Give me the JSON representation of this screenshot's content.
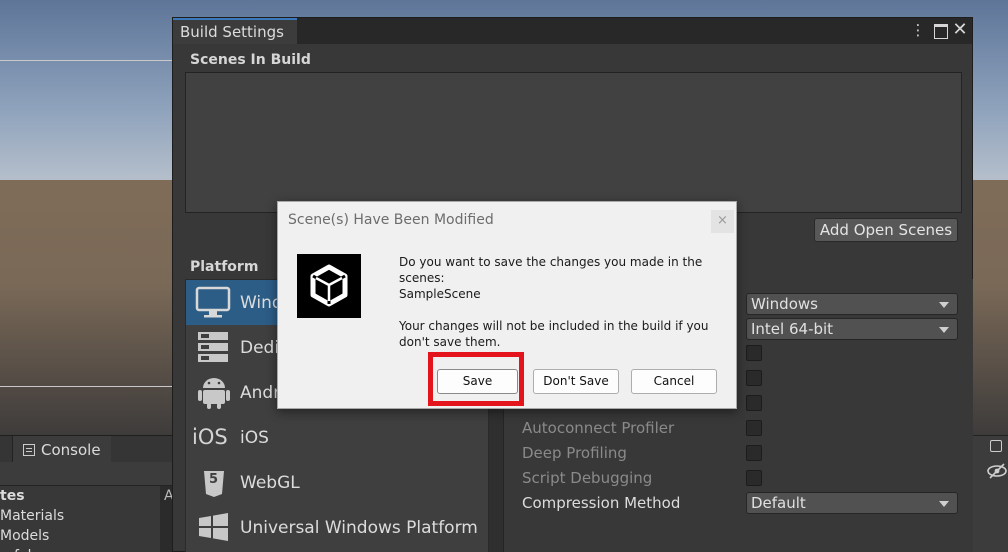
{
  "console": {
    "tab_label": "Console"
  },
  "project_tree": {
    "header": "tes",
    "items": [
      "Materials",
      "Models",
      "refabs"
    ],
    "sep_glyph": "A"
  },
  "build_window": {
    "title": "Build Settings",
    "scenes_label": "Scenes In Build",
    "add_open_scenes": "Add Open Scenes",
    "platform_label": "Platform",
    "platforms": [
      {
        "label": "Windows",
        "icon": "monitor-icon"
      },
      {
        "label": "Dedicated Server",
        "icon": "server-icon"
      },
      {
        "label": "Android",
        "icon": "android-icon"
      },
      {
        "label": "iOS",
        "icon": "ios-icon",
        "icon_text": "iOS"
      },
      {
        "label": "WebGL",
        "icon": "html5-icon",
        "icon_text": "5"
      },
      {
        "label": "Universal Windows Platform",
        "icon": "windows-logo-icon"
      }
    ],
    "settings": {
      "target_platform_value": "Windows",
      "architecture_value": "Intel 64-bit",
      "autoconnect_profiler": "Autoconnect Profiler",
      "deep_profiling": "Deep Profiling",
      "script_debugging": "Script Debugging",
      "compression_method": "Compression Method",
      "compression_value": "Default"
    }
  },
  "dialog": {
    "title": "Scene(s) Have Been Modified",
    "close_glyph": "×",
    "message_line1": "Do you want to save the changes you made in the",
    "message_line2": "scenes:",
    "scene_name": " SampleScene",
    "note_line1": "Your changes will not be included in the build if you",
    "note_line2": "don't save them.",
    "save_label": "Save",
    "dont_save_label": "Don't Save",
    "cancel_label": "Cancel"
  },
  "colors": {
    "selection_blue": "#2c5d87",
    "highlight_red": "#e3141b",
    "tab_accent": "#3a79bb"
  }
}
